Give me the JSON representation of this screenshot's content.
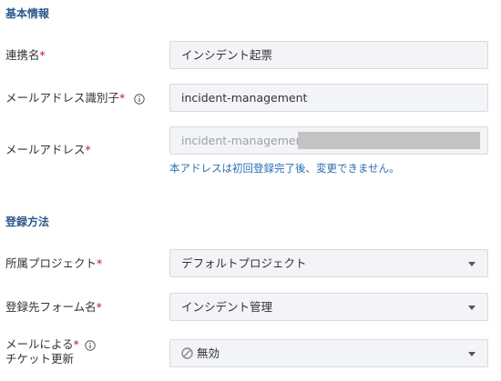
{
  "basic_info": {
    "title": "基本情報",
    "name_label": "連携名",
    "name_value": "インシデント起票",
    "mail_id_label": "メールアドレス識別子",
    "mail_id_value": "incident-management",
    "mail_address_label": "メールアドレス",
    "mail_address_value": "incident-management",
    "note": "本アドレスは初回登録完了後、変更できません。"
  },
  "registration": {
    "title": "登録方法",
    "project_label": "所属プロジェクト",
    "project_value": "デフォルトプロジェクト",
    "form_label": "登録先フォーム名",
    "form_value": "インシデント管理",
    "update_label_line1": "メールによる",
    "update_label_line2": "チケット更新",
    "update_value": "無効"
  },
  "required_mark": "*",
  "colors": {
    "section_title": "#2c5a8c",
    "required": "#c0152f",
    "note": "#2b6db4",
    "field_bg": "#f2f4f7"
  }
}
